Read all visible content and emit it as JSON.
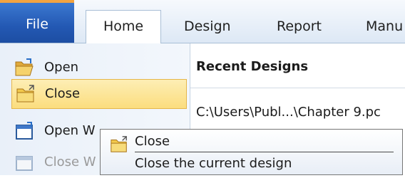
{
  "tabs": {
    "file": "File",
    "home": "Home",
    "design": "Design",
    "report": "Report",
    "manu": "Manu"
  },
  "menu": {
    "open": "Open",
    "close": "Close",
    "open_window": "Open W",
    "close_window": "Close W"
  },
  "recent": {
    "title": "Recent Designs",
    "item": "C:\\Users\\Publ...\\Chapter 9.pc"
  },
  "tooltip": {
    "title": "Close",
    "description": "Close the current design"
  },
  "colors": {
    "file_tab": "#2358b3",
    "selection": "#fbdd7e",
    "folder": "#f2c94c"
  },
  "icons": {
    "open": "open-folder-icon",
    "close": "close-folder-icon",
    "open_window": "open-window-icon",
    "close_window": "close-window-icon"
  }
}
